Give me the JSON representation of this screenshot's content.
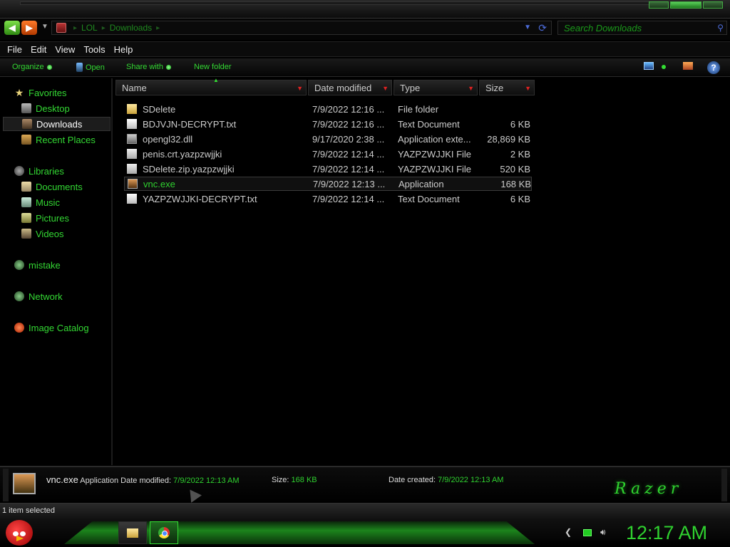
{
  "address": {
    "breadcrumbs": [
      "LOL",
      "Downloads"
    ],
    "search_placeholder": "Search Downloads"
  },
  "menu": [
    "File",
    "Edit",
    "View",
    "Tools",
    "Help"
  ],
  "commands": {
    "organize": "Organize",
    "open": "Open",
    "share_with": "Share with",
    "new_folder": "New folder"
  },
  "nav": {
    "favorites": "Favorites",
    "desktop": "Desktop",
    "downloads": "Downloads",
    "recent_places": "Recent Places",
    "libraries": "Libraries",
    "documents": "Documents",
    "music": "Music",
    "pictures": "Pictures",
    "videos": "Videos",
    "homegroup": "mistake",
    "network": "Network",
    "image_catalog": "Image Catalog"
  },
  "columns": {
    "name": "Name",
    "date_modified": "Date modified",
    "type": "Type",
    "size": "Size"
  },
  "files": [
    {
      "name": "SDelete",
      "date": "7/9/2022 12:16 ...",
      "type": "File folder",
      "size": "",
      "icon": "folder-icon"
    },
    {
      "name": "BDJVJN-DECRYPT.txt",
      "date": "7/9/2022 12:16 ...",
      "type": "Text Document",
      "size": "6 KB",
      "icon": "text-file-icon"
    },
    {
      "name": "opengl32.dll",
      "date": "9/17/2020 2:38 ...",
      "type": "Application exte...",
      "size": "28,869 KB",
      "icon": "dll-file-icon"
    },
    {
      "name": "penis.crt.yazpzwjjki",
      "date": "7/9/2022 12:14 ...",
      "type": "YAZPZWJJKI File",
      "size": "2 KB",
      "icon": "generic-file-icon"
    },
    {
      "name": "SDelete.zip.yazpzwjjki",
      "date": "7/9/2022 12:14 ...",
      "type": "YAZPZWJJKI File",
      "size": "520 KB",
      "icon": "generic-file-icon"
    },
    {
      "name": "vnc.exe",
      "date": "7/9/2022 12:13 ...",
      "type": "Application",
      "size": "168 KB",
      "icon": "application-icon",
      "selected": true
    },
    {
      "name": "YAZPZWJJKI-DECRYPT.txt",
      "date": "7/9/2022 12:14 ...",
      "type": "Text Document",
      "size": "6 KB",
      "icon": "text-file-icon"
    }
  ],
  "details": {
    "filename": "vnc.exe",
    "filetype": "Application",
    "date_modified_label": "Date modified:",
    "date_modified_value": "7/9/2022 12:13 AM",
    "size_label": "Size:",
    "size_value": "168 KB",
    "date_created_label": "Date created:",
    "date_created_value": "7/9/2022 12:13 AM",
    "brand": "Razer"
  },
  "status": "1 item selected",
  "taskbar": {
    "clock": "12:17 AM"
  },
  "colors": {
    "accent_green": "#2fd12f",
    "background": "#000000",
    "sort_red": "#dd2222"
  }
}
